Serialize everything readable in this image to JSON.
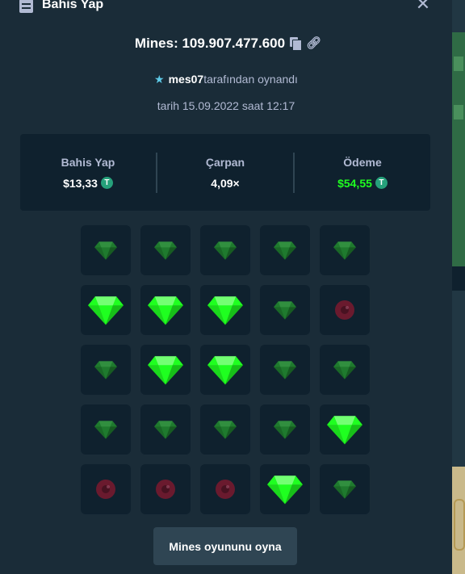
{
  "header": {
    "title": "Bahis Yap",
    "close_label": "✕"
  },
  "game": {
    "title": "Mines: 109.907.477.600"
  },
  "player": {
    "name": "mes07",
    "suffix": "tarafından oynandı"
  },
  "date": "tarih 15.09.2022 saat 12:17",
  "stats": {
    "bet": {
      "label": "Bahis Yap",
      "value": "$13,33"
    },
    "multiplier": {
      "label": "Çarpan",
      "value": "4,09×"
    },
    "payout": {
      "label": "Ödeme",
      "value": "$54,55"
    }
  },
  "currency_icon": "T",
  "grid": [
    [
      "gem-dim",
      "gem-dim",
      "gem-dim",
      "gem-dim",
      "gem-dim"
    ],
    [
      "gem",
      "gem",
      "gem",
      "gem-dim",
      "mine-dim"
    ],
    [
      "gem-dim",
      "gem",
      "gem",
      "gem-dim",
      "gem-dim"
    ],
    [
      "gem-dim",
      "gem-dim",
      "gem-dim",
      "gem-dim",
      "gem"
    ],
    [
      "mine-dim",
      "mine-dim",
      "mine-dim",
      "gem",
      "gem-dim"
    ]
  ],
  "play_button": "Mines oyununu oyna",
  "colors": {
    "background": "#1a2c38",
    "panel": "#0f212e",
    "gem_bright": "#1fff20",
    "gem_dim": "#1f7a2e",
    "mine_dim": "#6a1a2e",
    "payout_green": "#1fff20"
  }
}
